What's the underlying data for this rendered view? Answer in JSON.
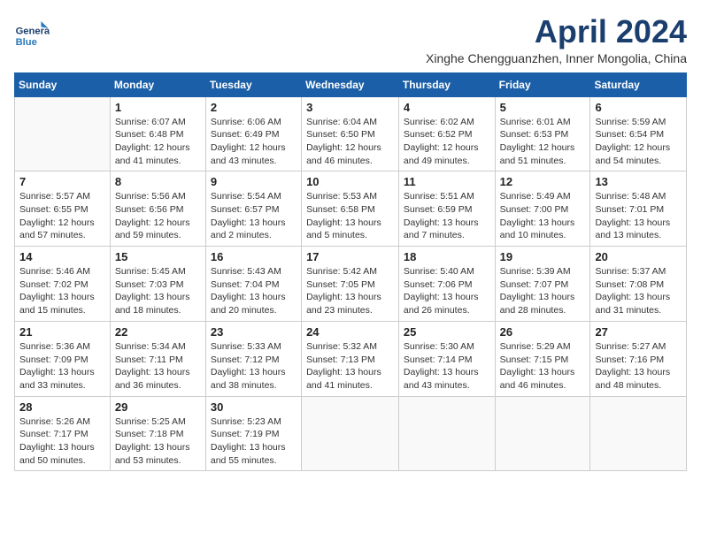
{
  "header": {
    "logo_general": "General",
    "logo_blue": "Blue",
    "title": "April 2024",
    "subtitle": "Xinghe Chengguanzhen, Inner Mongolia, China"
  },
  "columns": [
    "Sunday",
    "Monday",
    "Tuesday",
    "Wednesday",
    "Thursday",
    "Friday",
    "Saturday"
  ],
  "weeks": [
    [
      {
        "day": "",
        "info": ""
      },
      {
        "day": "1",
        "info": "Sunrise: 6:07 AM\nSunset: 6:48 PM\nDaylight: 12 hours\nand 41 minutes."
      },
      {
        "day": "2",
        "info": "Sunrise: 6:06 AM\nSunset: 6:49 PM\nDaylight: 12 hours\nand 43 minutes."
      },
      {
        "day": "3",
        "info": "Sunrise: 6:04 AM\nSunset: 6:50 PM\nDaylight: 12 hours\nand 46 minutes."
      },
      {
        "day": "4",
        "info": "Sunrise: 6:02 AM\nSunset: 6:52 PM\nDaylight: 12 hours\nand 49 minutes."
      },
      {
        "day": "5",
        "info": "Sunrise: 6:01 AM\nSunset: 6:53 PM\nDaylight: 12 hours\nand 51 minutes."
      },
      {
        "day": "6",
        "info": "Sunrise: 5:59 AM\nSunset: 6:54 PM\nDaylight: 12 hours\nand 54 minutes."
      }
    ],
    [
      {
        "day": "7",
        "info": "Sunrise: 5:57 AM\nSunset: 6:55 PM\nDaylight: 12 hours\nand 57 minutes."
      },
      {
        "day": "8",
        "info": "Sunrise: 5:56 AM\nSunset: 6:56 PM\nDaylight: 12 hours\nand 59 minutes."
      },
      {
        "day": "9",
        "info": "Sunrise: 5:54 AM\nSunset: 6:57 PM\nDaylight: 13 hours\nand 2 minutes."
      },
      {
        "day": "10",
        "info": "Sunrise: 5:53 AM\nSunset: 6:58 PM\nDaylight: 13 hours\nand 5 minutes."
      },
      {
        "day": "11",
        "info": "Sunrise: 5:51 AM\nSunset: 6:59 PM\nDaylight: 13 hours\nand 7 minutes."
      },
      {
        "day": "12",
        "info": "Sunrise: 5:49 AM\nSunset: 7:00 PM\nDaylight: 13 hours\nand 10 minutes."
      },
      {
        "day": "13",
        "info": "Sunrise: 5:48 AM\nSunset: 7:01 PM\nDaylight: 13 hours\nand 13 minutes."
      }
    ],
    [
      {
        "day": "14",
        "info": "Sunrise: 5:46 AM\nSunset: 7:02 PM\nDaylight: 13 hours\nand 15 minutes."
      },
      {
        "day": "15",
        "info": "Sunrise: 5:45 AM\nSunset: 7:03 PM\nDaylight: 13 hours\nand 18 minutes."
      },
      {
        "day": "16",
        "info": "Sunrise: 5:43 AM\nSunset: 7:04 PM\nDaylight: 13 hours\nand 20 minutes."
      },
      {
        "day": "17",
        "info": "Sunrise: 5:42 AM\nSunset: 7:05 PM\nDaylight: 13 hours\nand 23 minutes."
      },
      {
        "day": "18",
        "info": "Sunrise: 5:40 AM\nSunset: 7:06 PM\nDaylight: 13 hours\nand 26 minutes."
      },
      {
        "day": "19",
        "info": "Sunrise: 5:39 AM\nSunset: 7:07 PM\nDaylight: 13 hours\nand 28 minutes."
      },
      {
        "day": "20",
        "info": "Sunrise: 5:37 AM\nSunset: 7:08 PM\nDaylight: 13 hours\nand 31 minutes."
      }
    ],
    [
      {
        "day": "21",
        "info": "Sunrise: 5:36 AM\nSunset: 7:09 PM\nDaylight: 13 hours\nand 33 minutes."
      },
      {
        "day": "22",
        "info": "Sunrise: 5:34 AM\nSunset: 7:11 PM\nDaylight: 13 hours\nand 36 minutes."
      },
      {
        "day": "23",
        "info": "Sunrise: 5:33 AM\nSunset: 7:12 PM\nDaylight: 13 hours\nand 38 minutes."
      },
      {
        "day": "24",
        "info": "Sunrise: 5:32 AM\nSunset: 7:13 PM\nDaylight: 13 hours\nand 41 minutes."
      },
      {
        "day": "25",
        "info": "Sunrise: 5:30 AM\nSunset: 7:14 PM\nDaylight: 13 hours\nand 43 minutes."
      },
      {
        "day": "26",
        "info": "Sunrise: 5:29 AM\nSunset: 7:15 PM\nDaylight: 13 hours\nand 46 minutes."
      },
      {
        "day": "27",
        "info": "Sunrise: 5:27 AM\nSunset: 7:16 PM\nDaylight: 13 hours\nand 48 minutes."
      }
    ],
    [
      {
        "day": "28",
        "info": "Sunrise: 5:26 AM\nSunset: 7:17 PM\nDaylight: 13 hours\nand 50 minutes."
      },
      {
        "day": "29",
        "info": "Sunrise: 5:25 AM\nSunset: 7:18 PM\nDaylight: 13 hours\nand 53 minutes."
      },
      {
        "day": "30",
        "info": "Sunrise: 5:23 AM\nSunset: 7:19 PM\nDaylight: 13 hours\nand 55 minutes."
      },
      {
        "day": "",
        "info": ""
      },
      {
        "day": "",
        "info": ""
      },
      {
        "day": "",
        "info": ""
      },
      {
        "day": "",
        "info": ""
      }
    ]
  ]
}
